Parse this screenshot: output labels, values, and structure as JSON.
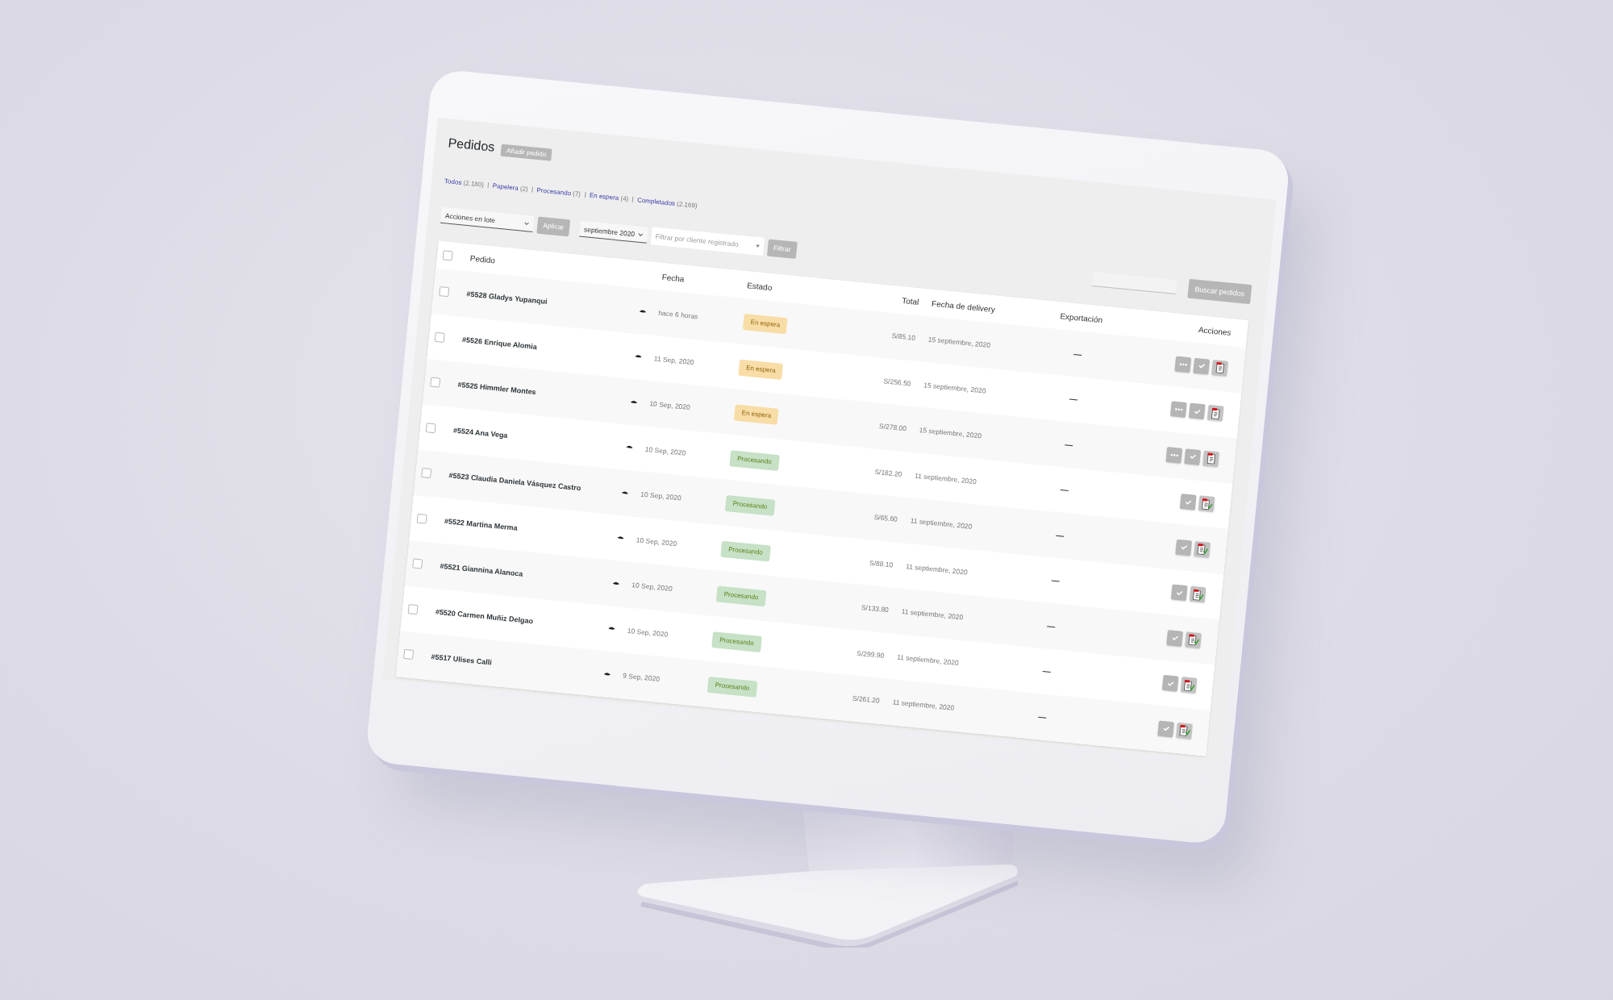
{
  "page_header": {
    "title": "Pedidos",
    "add_button": "Añadir pedido"
  },
  "status_filters": [
    {
      "label": "Todos",
      "count": "(2.180)"
    },
    {
      "label": "Papelera",
      "count": "(2)"
    },
    {
      "label": "Procesando",
      "count": "(7)"
    },
    {
      "label": "En espera",
      "count": "(4)"
    },
    {
      "label": "Completados",
      "count": "(2.169)"
    }
  ],
  "toolbar": {
    "bulk_actions": {
      "value": "Acciones en lote"
    },
    "apply_button": "Aplicar",
    "month_filter": {
      "value": "septiembre 2020"
    },
    "customer_filter": {
      "placeholder": "Filtrar por cliente registrado"
    },
    "filter_button": "Filtrar",
    "search_button": "Buscar pedidos"
  },
  "table": {
    "select_all": {
      "checked": false
    },
    "columns": [
      "Pedido",
      "Fecha",
      "Estado",
      "Total",
      "Fecha de delivery",
      "Exportación",
      "Acciones"
    ],
    "rows": [
      {
        "checked": false,
        "order": "#5528 Gladys Yupanqui",
        "date": "hace 6 horas",
        "status": {
          "label": "En espera",
          "kind": "on-hold"
        },
        "total": "S/85.10",
        "delivery": "15 septiembre, 2020",
        "export": "—",
        "actions": [
          {
            "kind": "more"
          },
          {
            "kind": "complete"
          },
          {
            "kind": "invoice"
          }
        ]
      },
      {
        "checked": false,
        "order": "#5526 Enrique Alomia",
        "date": "11 Sep, 2020",
        "status": {
          "label": "En espera",
          "kind": "on-hold"
        },
        "total": "S/256.50",
        "delivery": "15 septiembre, 2020",
        "export": "—",
        "actions": [
          {
            "kind": "more"
          },
          {
            "kind": "complete"
          },
          {
            "kind": "invoice"
          }
        ]
      },
      {
        "checked": false,
        "order": "#5525 Himmler Montes",
        "date": "10 Sep, 2020",
        "status": {
          "label": "En espera",
          "kind": "on-hold"
        },
        "total": "S/278.00",
        "delivery": "15 septiembre, 2020",
        "export": "—",
        "actions": [
          {
            "kind": "more"
          },
          {
            "kind": "complete"
          },
          {
            "kind": "invoice"
          }
        ]
      },
      {
        "checked": false,
        "order": "#5524 Ana Vega",
        "date": "10 Sep, 2020",
        "status": {
          "label": "Procesando",
          "kind": "processing"
        },
        "total": "S/182.20",
        "delivery": "11 septiembre, 2020",
        "export": "—",
        "actions": [
          {
            "kind": "complete"
          },
          {
            "kind": "invoiced"
          }
        ]
      },
      {
        "checked": false,
        "order": "#5523 Claudia Daniela Vásquez Castro",
        "date": "10 Sep, 2020",
        "status": {
          "label": "Procesando",
          "kind": "processing"
        },
        "total": "S/65.60",
        "delivery": "11 septiembre, 2020",
        "export": "—",
        "actions": [
          {
            "kind": "complete"
          },
          {
            "kind": "invoiced"
          }
        ]
      },
      {
        "checked": false,
        "order": "#5522 Martina Merma",
        "date": "10 Sep, 2020",
        "status": {
          "label": "Procesando",
          "kind": "processing"
        },
        "total": "S/88.10",
        "delivery": "11 septiembre, 2020",
        "export": "—",
        "actions": [
          {
            "kind": "complete"
          },
          {
            "kind": "invoiced"
          }
        ]
      },
      {
        "checked": false,
        "order": "#5521 Giannina Alanoca",
        "date": "10 Sep, 2020",
        "status": {
          "label": "Procesando",
          "kind": "processing"
        },
        "total": "S/133.80",
        "delivery": "11 septiembre, 2020",
        "export": "—",
        "actions": [
          {
            "kind": "complete"
          },
          {
            "kind": "invoiced"
          }
        ]
      },
      {
        "checked": false,
        "order": "#5520 Carmen Muñiz Delgao",
        "date": "10 Sep, 2020",
        "status": {
          "label": "Procesando",
          "kind": "processing"
        },
        "total": "S/299.90",
        "delivery": "11 septiembre, 2020",
        "export": "—",
        "actions": [
          {
            "kind": "complete"
          },
          {
            "kind": "invoiced"
          }
        ]
      },
      {
        "checked": false,
        "order": "#5517 Ulises Calli",
        "date": "9 Sep, 2020",
        "status": {
          "label": "Procesando",
          "kind": "processing"
        },
        "total": "S/261.20",
        "delivery": "11 septiembre, 2020",
        "export": "—",
        "actions": [
          {
            "kind": "complete"
          },
          {
            "kind": "invoiced"
          }
        ]
      }
    ]
  }
}
